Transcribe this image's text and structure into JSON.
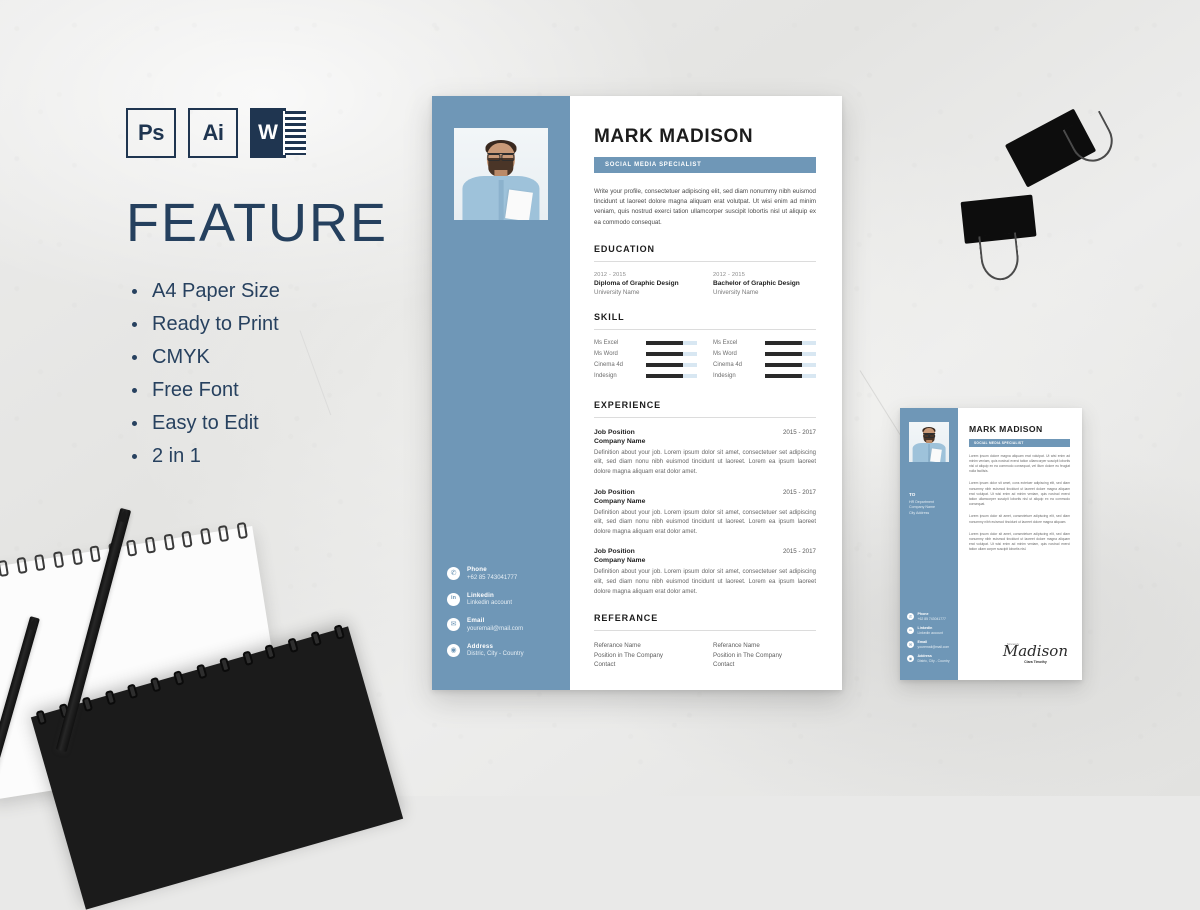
{
  "scene": {
    "background_color": "#e9e9e8",
    "objects": [
      "white-spiral-notepad",
      "black-spiral-notebook",
      "black-pencil",
      "black-pencil",
      "binder-clip",
      "binder-clip"
    ]
  },
  "feature_panel": {
    "app_icons": [
      {
        "name": "photoshop-icon",
        "label": "Ps"
      },
      {
        "name": "illustrator-icon",
        "label": "Ai"
      },
      {
        "name": "word-icon",
        "label": "W"
      }
    ],
    "title": "FEATURE",
    "items": [
      "A4 Paper Size",
      "Ready to Print",
      "CMYK",
      "Free Font",
      "Easy to Edit",
      "2 in 1"
    ],
    "accent_color": "#25405e"
  },
  "resume": {
    "accent_color": "#6f97b7",
    "name": "MARK MADISON",
    "job_title": "SOCIAL MEDIA SPECIALIST",
    "profile": "Write your profile, consectetuer adipiscing elit, sed diam nonummy nibh euismod tincidunt ut laoreet dolore magna aliquam erat volutpat. Ut wisi enim ad minim veniam, quis nostrud exerci tation ullamcorper suscipit lobortis nisl ut aliquip ex ea commodo consequat.",
    "sections": {
      "education": "EDUCATION",
      "skill": "SKILL",
      "experience": "EXPERIENCE",
      "referance": "REFERANCE"
    },
    "education": [
      {
        "date": "2012 - 2015",
        "degree": "Diploma of Graphic Design",
        "school": "University Name"
      },
      {
        "date": "2012 - 2015",
        "degree": "Bachelor of Graphic Design",
        "school": "University Name"
      }
    ],
    "skills_left": [
      {
        "name": "Ms Excel",
        "level": 72
      },
      {
        "name": "Ms Word",
        "level": 72
      },
      {
        "name": "Cinema 4d",
        "level": 72
      },
      {
        "name": "Indesign",
        "level": 72
      }
    ],
    "skills_right": [
      {
        "name": "Ms Excel",
        "level": 72
      },
      {
        "name": "Ms Word",
        "level": 72
      },
      {
        "name": "Cinema 4d",
        "level": 72
      },
      {
        "name": "Indesign",
        "level": 72
      }
    ],
    "experience": [
      {
        "position": "Job Position",
        "company": "Company Name",
        "date": "2015 - 2017",
        "description": "Definition about your job. Lorem ipsum dolor sit amet, consectetuer set adipiscing elit, sed diam nonu nibh euismod tincidunt ut laoreet. Lorem ea ipsum laoreet dolore magna aliquam erat dolor amet."
      },
      {
        "position": "Job Position",
        "company": "Company Name",
        "date": "2015 - 2017",
        "description": "Definition about your job. Lorem ipsum dolor sit amet, consectetuer set adipiscing elit, sed diam nonu nibh euismod tincidunt ut laoreet. Lorem ea ipsum laoreet dolore magna aliquam erat dolor amet."
      },
      {
        "position": "Job Position",
        "company": "Company Name",
        "date": "2015 - 2017",
        "description": "Definition about your job. Lorem ipsum dolor sit amet, consectetuer set adipiscing elit, sed diam nonu nibh euismod tincidunt ut laoreet. Lorem ea ipsum laoreet dolore magna aliquam erat dolor amet."
      }
    ],
    "referance": [
      {
        "name": "Referance Name",
        "position": "Position in The Company",
        "contact": "Contact"
      },
      {
        "name": "Referance Name",
        "position": "Position in The Company",
        "contact": "Contact"
      }
    ],
    "contacts": [
      {
        "icon": "phone-icon",
        "glyph": "✆",
        "label": "Phone",
        "value": "+62 85 743041777"
      },
      {
        "icon": "linkedin-icon",
        "glyph": "in",
        "label": "Linkedin",
        "value": "Linkedin account"
      },
      {
        "icon": "email-icon",
        "glyph": "✉",
        "label": "Email",
        "value": "youremail@mail.com"
      },
      {
        "icon": "address-icon",
        "glyph": "◉",
        "label": "Address",
        "value": "Distric, City - Country"
      }
    ]
  },
  "cover_letter": {
    "name": "MARK MADISON",
    "job_title": "SOCIAL MEDIA SPECIALIST",
    "to_label": "TO",
    "to_lines": [
      "HR Department",
      "Company Name",
      "City Address"
    ],
    "paragraphs": [
      "Lorem ipsum dolore magna aliquam erat volutpat. Ut wisi enim ad minim veniam, quis nostrud exerci tation ullamcorper suscipit lobortis nisl ut aliquip ex ea commodo consequat, vel illum dolore eu feugiat nulla facilisis.",
      "Lorem ipsum dolor sit amet, cons ectetuer adipiscing elit, sed diam nonummy nibh euismod tincidunt ut laoreet dolore magna aliquam erat volutpat. Ut wisi enim ad minim veniam, quis nostrud exerci tation ullamcorper suscipit lobortis nisl ut aliquip ex ea commodo consequat.",
      "Lorem ipsum dolor sit amet, consectetuer adipiscing elit, sed diam nonummy nibh euismod tincidunt ut laoreet dolore magna aliquam.",
      "Lorem ipsum dolor sit amet, consectetuer adipiscing elit, sed diam nonummy nibh euismod tincidunt ut laoreet dolore magna aliquam erat volutpat. Ut wisi enim ad minim veniam, quis nostrud exerci tation ullam corper suscipit lobortis nisl."
    ],
    "signature_pre": "Sincerely",
    "signature": "Madison",
    "signature_sub": "Clara Timothy",
    "contacts": [
      {
        "icon": "phone-icon",
        "glyph": "✆",
        "label": "Phone",
        "value": "+62 85 743041777"
      },
      {
        "icon": "linkedin-icon",
        "glyph": "in",
        "label": "Linkedin",
        "value": "Linkedin account"
      },
      {
        "icon": "email-icon",
        "glyph": "✉",
        "label": "Email",
        "value": "youremail@mail.com"
      },
      {
        "icon": "address-icon",
        "glyph": "◉",
        "label": "Address",
        "value": "Distric, City - Country"
      }
    ]
  }
}
